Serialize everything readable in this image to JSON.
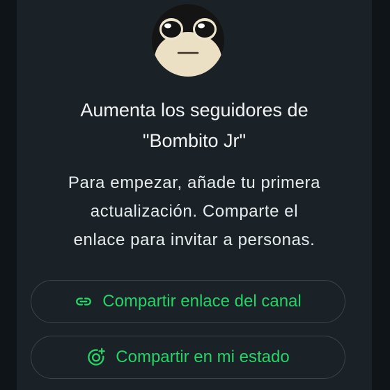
{
  "channel": {
    "name": "Bombito Jr",
    "avatar_icon": "plush-toy-avatar"
  },
  "header": {
    "title_line1": "Aumenta los seguidores de",
    "title_line2": "\"Bombito Jr\""
  },
  "body": {
    "line1": "Para empezar, añade tu primera",
    "line2": "actualización. Comparte el",
    "line3": "enlace para invitar a personas."
  },
  "actions": {
    "share_link_label": "Compartir enlace del canal",
    "share_link_icon": "link-icon",
    "share_status_label": "Compartir en mi estado",
    "share_status_icon": "status-add-icon"
  },
  "colors": {
    "accent": "#25d366",
    "background": "#1a2227",
    "text": "#f1f3f4"
  }
}
